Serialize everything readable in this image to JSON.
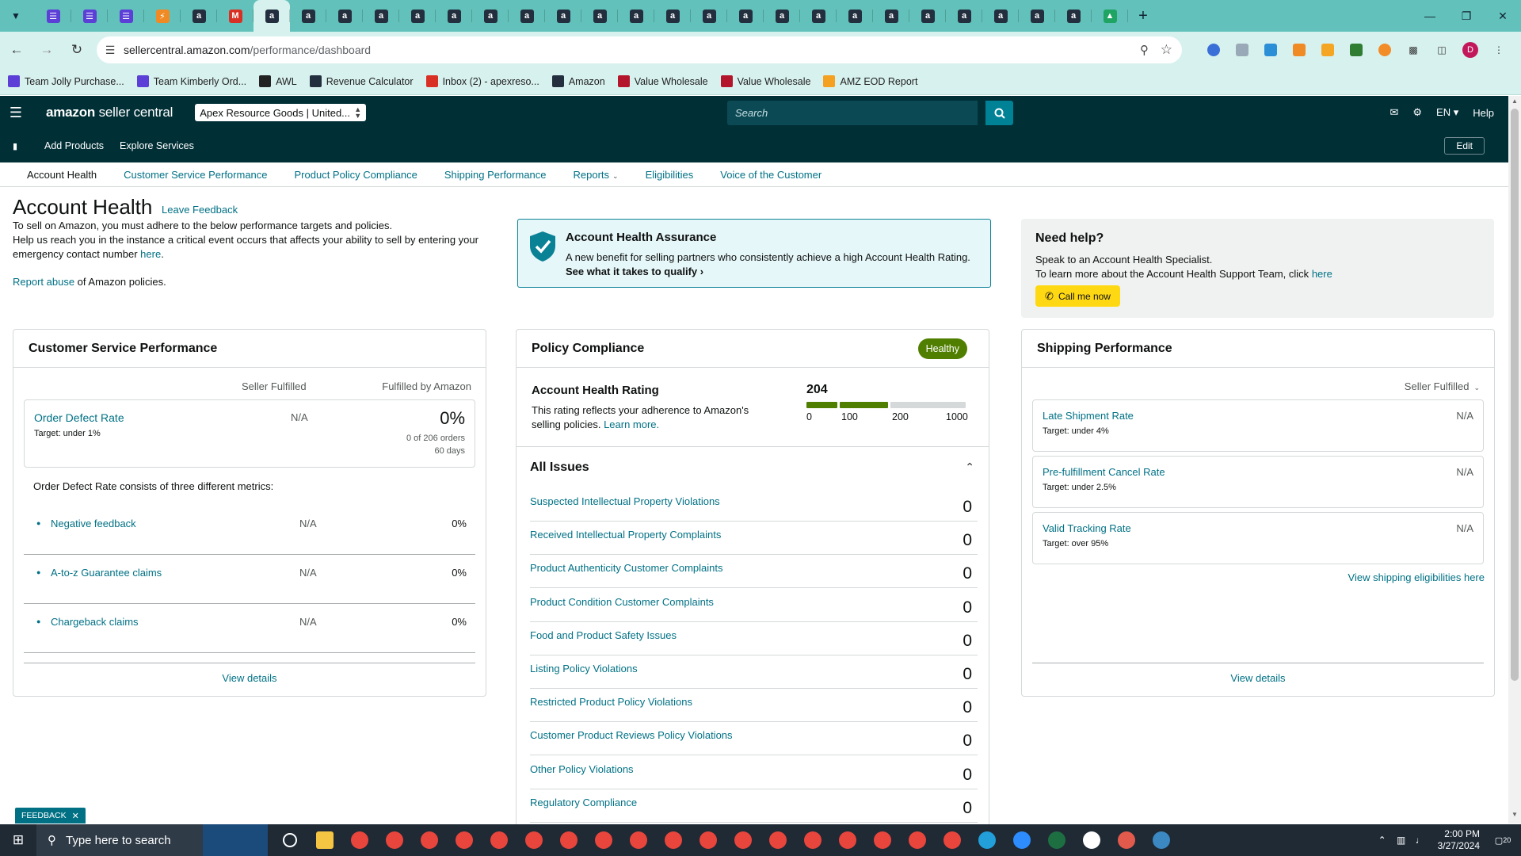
{
  "browser": {
    "url_domain": "sellercentral.amazon.com",
    "url_path": "/performance/dashboard",
    "bookmarks": [
      {
        "label": "Team Jolly Purchase...",
        "icon": "purple-list-icon",
        "color": "#5b3fd6"
      },
      {
        "label": "Team Kimberly Ord...",
        "icon": "purple-list-icon",
        "color": "#5b3fd6"
      },
      {
        "label": "AWL",
        "icon": "awl-icon",
        "color": "#222222"
      },
      {
        "label": "Revenue Calculator",
        "icon": "amazon-icon",
        "color": "#232f3e"
      },
      {
        "label": "Inbox (2) - apexreso...",
        "icon": "gmail-icon",
        "color": "#d93025"
      },
      {
        "label": "Amazon",
        "icon": "amazon-icon",
        "color": "#232f3e"
      },
      {
        "label": "Value Wholesale",
        "icon": "vw-icon",
        "color": "#b3162c"
      },
      {
        "label": "Value Wholesale",
        "icon": "vw-icon",
        "color": "#b3162c"
      },
      {
        "label": "AMZ EOD Report",
        "icon": "report-icon",
        "color": "#f4a020"
      }
    ],
    "profile_initial": "D"
  },
  "header": {
    "brand_strong": "amazon",
    "brand_rest": " seller central",
    "account": "Apex Resource Goods | United...",
    "search_placeholder": "Search",
    "language": "EN",
    "help": "Help"
  },
  "subbar": {
    "add_products": "Add Products",
    "explore_services": "Explore Services",
    "edit": "Edit"
  },
  "pagenav": [
    "Account Health",
    "Customer Service Performance",
    "Product Policy Compliance",
    "Shipping Performance",
    "Reports",
    "Eligibilities",
    "Voice of the Customer"
  ],
  "intro": {
    "title": "Account Health",
    "leave_feedback": "Leave Feedback",
    "line1": "To sell on Amazon, you must adhere to the below performance targets and policies.",
    "line2": "Help us reach you in the instance a critical event occurs that affects your ability to sell by entering your emergency contact number",
    "here": "here",
    "report_abuse": "Report abuse",
    "report_rest": " of Amazon policies."
  },
  "assurance": {
    "title": "Account Health Assurance",
    "desc": "A new benefit for selling partners who consistently achieve a high Account Health Rating.",
    "qualify": "See what it takes to qualify"
  },
  "help": {
    "title": "Need help?",
    "line1": "Speak to an Account Health Specialist.",
    "line2": "To learn more about the Account Health Support Team, click",
    "here": "here",
    "call": "Call me now"
  },
  "csp": {
    "title": "Customer Service Performance",
    "col_seller": "Seller Fulfilled",
    "col_fba": "Fulfilled by Amazon",
    "odr_name": "Order Defect Rate",
    "odr_target": "Target: under 1%",
    "odr_seller": "N/A",
    "odr_pct": "0%",
    "odr_orders": "0 of 206 orders",
    "odr_days": "60 days",
    "consists": "Order Defect Rate consists of three different metrics:",
    "metrics": [
      {
        "name": "Negative feedback",
        "seller": "N/A",
        "fba": "0%"
      },
      {
        "name": "A-to-z Guarantee claims",
        "seller": "N/A",
        "fba": "0%"
      },
      {
        "name": "Chargeback claims",
        "seller": "N/A",
        "fba": "0%"
      }
    ],
    "view_details": "View details"
  },
  "pc": {
    "title": "Policy Compliance",
    "status": "Healthy",
    "ahr_title": "Account Health Rating",
    "ahr_desc": "This rating reflects your adherence to Amazon's selling policies.",
    "learn_more": "Learn more.",
    "score": "204",
    "score_value": 204,
    "scale": [
      "0",
      "100",
      "200",
      "1000"
    ],
    "all_issues": "All Issues",
    "issues": [
      {
        "name": "Suspected Intellectual Property Violations",
        "count": "0"
      },
      {
        "name": "Received Intellectual Property Complaints",
        "count": "0"
      },
      {
        "name": "Product Authenticity Customer Complaints",
        "count": "0"
      },
      {
        "name": "Product Condition Customer Complaints",
        "count": "0"
      },
      {
        "name": "Food and Product Safety Issues",
        "count": "0"
      },
      {
        "name": "Listing Policy Violations",
        "count": "0"
      },
      {
        "name": "Restricted Product Policy Violations",
        "count": "0"
      },
      {
        "name": "Customer Product Reviews Policy Violations",
        "count": "0"
      },
      {
        "name": "Other Policy Violations",
        "count": "0"
      },
      {
        "name": "Regulatory Compliance",
        "count": "0"
      }
    ]
  },
  "sp": {
    "title": "Shipping Performance",
    "selector": "Seller Fulfilled",
    "rows": [
      {
        "name": "Late Shipment Rate",
        "target": "Target: under 4%",
        "value": "N/A"
      },
      {
        "name": "Pre-fulfillment Cancel Rate",
        "target": "Target: under 2.5%",
        "value": "N/A"
      },
      {
        "name": "Valid Tracking Rate",
        "target": "Target: over 95%",
        "value": "N/A"
      }
    ],
    "eligibilities": "View shipping eligibilities here",
    "view_details": "View details"
  },
  "feedback_tab": "FEEDBACK",
  "taskbar": {
    "search_placeholder": "Type here to search",
    "time": "2:00 PM",
    "date": "3/27/2024",
    "notifications": "20"
  },
  "colors": {
    "header_bg": "#002f36",
    "link": "#007185",
    "healthy": "#507f00",
    "call_button": "#ffd814"
  }
}
